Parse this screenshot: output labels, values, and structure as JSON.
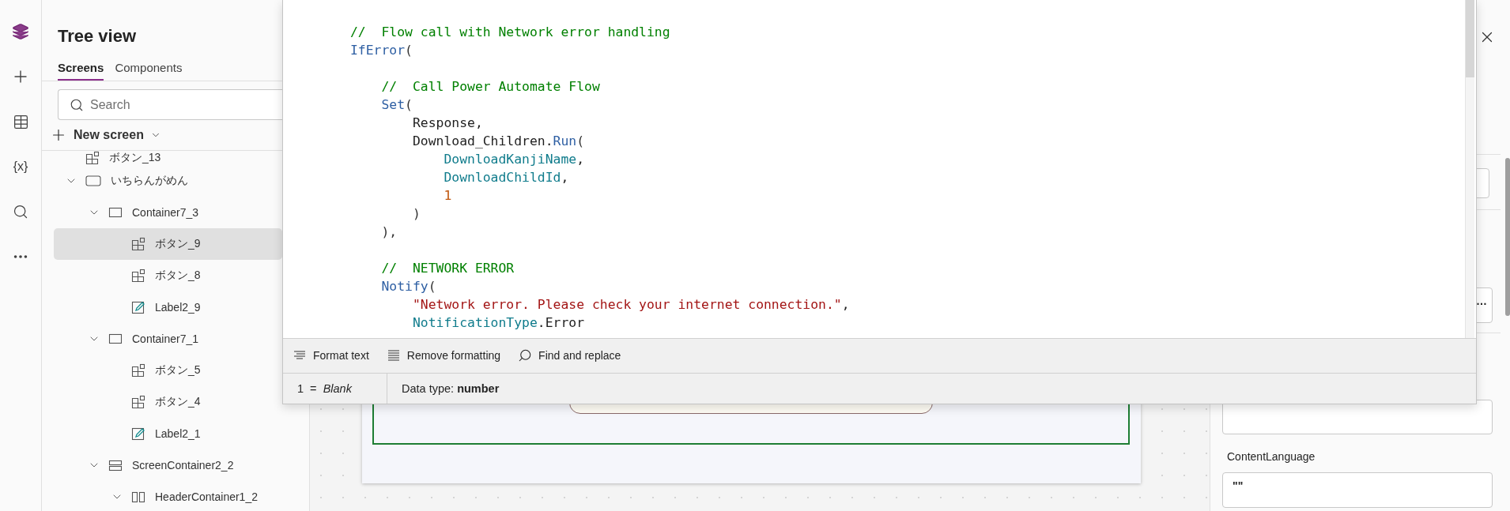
{
  "rail": [
    {
      "kind": "layers",
      "selected": true
    },
    {
      "kind": "insert",
      "selected": false
    },
    {
      "kind": "data",
      "selected": false
    },
    {
      "kind": "variables",
      "glyph": "{x}",
      "selected": false
    },
    {
      "kind": "search",
      "selected": false
    },
    {
      "kind": "more",
      "selected": false
    }
  ],
  "tree_panel": {
    "title": "Tree view",
    "tabs": [
      {
        "label": "Screens",
        "selected": true
      },
      {
        "label": "Components",
        "selected": false
      }
    ],
    "search": {
      "placeholder": "Search"
    },
    "new_screen": "New screen",
    "items": [
      {
        "label": "ボタン_13",
        "kind": "button",
        "selected": false
      },
      {
        "label": "いちらんがめん",
        "kind": "screen",
        "selected": false,
        "expanded": true,
        "children": [
          {
            "label": "Container7_3",
            "kind": "container",
            "selected": false,
            "expanded": true,
            "children": [
              {
                "label": "ボタン_9",
                "kind": "button",
                "selected": true
              },
              {
                "label": "ボタン_8",
                "kind": "button",
                "selected": false
              },
              {
                "label": "Label2_9",
                "kind": "label",
                "selected": false
              }
            ]
          },
          {
            "label": "Container7_1",
            "kind": "container",
            "selected": false,
            "expanded": true,
            "children": [
              {
                "label": "ボタン_5",
                "kind": "button",
                "selected": false
              },
              {
                "label": "ボタン_4",
                "kind": "button",
                "selected": false
              },
              {
                "label": "Label2_1",
                "kind": "label",
                "selected": false
              }
            ]
          },
          {
            "label": "ScreenContainer2_2",
            "kind": "screen_container",
            "selected": false,
            "expanded": true,
            "children": [
              {
                "label": "HeaderContainer1_2",
                "kind": "header_container",
                "selected": false,
                "expanded": true
              }
            ]
          }
        ]
      }
    ]
  },
  "formula_editor": {
    "code_lines": [
      {
        "tokens": [
          {
            "text": "//  Flow call with Network error handling",
            "kind": "comment"
          }
        ]
      },
      {
        "tokens": [
          {
            "text": "IfError",
            "kind": "function"
          },
          {
            "text": "(",
            "kind": "punct"
          }
        ]
      },
      {
        "kind": "blank"
      },
      {
        "tokens": [
          {
            "text": "    //  Call Power Automate Flow",
            "kind": "comment"
          }
        ]
      },
      {
        "tokens": [
          {
            "text": "    Set",
            "kind": "function"
          },
          {
            "text": "(",
            "kind": "punct"
          }
        ]
      },
      {
        "tokens": [
          {
            "text": "        Response,",
            "kind": "plain"
          }
        ]
      },
      {
        "tokens": [
          {
            "text": "        Download_Children.",
            "kind": "plain"
          },
          {
            "text": "Run",
            "kind": "function"
          },
          {
            "text": "(",
            "kind": "punct"
          }
        ]
      },
      {
        "tokens": [
          {
            "text": "            DownloadKanjiName",
            "kind": "variable"
          },
          {
            "text": ",",
            "kind": "plain"
          }
        ]
      },
      {
        "tokens": [
          {
            "text": "            DownloadChildId",
            "kind": "variable"
          },
          {
            "text": ",",
            "kind": "plain"
          }
        ]
      },
      {
        "tokens": [
          {
            "text": "            1",
            "kind": "number"
          }
        ]
      },
      {
        "tokens": [
          {
            "text": "        )",
            "kind": "punct"
          }
        ]
      },
      {
        "tokens": [
          {
            "text": "    ),",
            "kind": "punct"
          }
        ]
      },
      {
        "kind": "blank"
      },
      {
        "tokens": [
          {
            "text": "    //  NETWORK ERROR",
            "kind": "comment"
          }
        ]
      },
      {
        "tokens": [
          {
            "text": "    Notify",
            "kind": "function"
          },
          {
            "text": "(",
            "kind": "punct"
          }
        ]
      },
      {
        "tokens": [
          {
            "text": "        \"Network error. Please check your internet connection.\"",
            "kind": "string"
          },
          {
            "text": ",",
            "kind": "plain"
          }
        ]
      },
      {
        "tokens": [
          {
            "text": "        NotificationType",
            "kind": "variable"
          },
          {
            "text": ".Error",
            "kind": "plain"
          }
        ]
      }
    ],
    "toolbar": [
      {
        "label": "Format text",
        "kind": "format"
      },
      {
        "label": "Remove formatting",
        "kind": "remove"
      },
      {
        "label": "Find and replace",
        "kind": "find"
      }
    ],
    "result": "1  =  *Blank*",
    "data_type": "Data type: **number**"
  },
  "properties": {
    "truncated_value": "…",
    "label": "ContentLanguage",
    "value": "\"\""
  }
}
